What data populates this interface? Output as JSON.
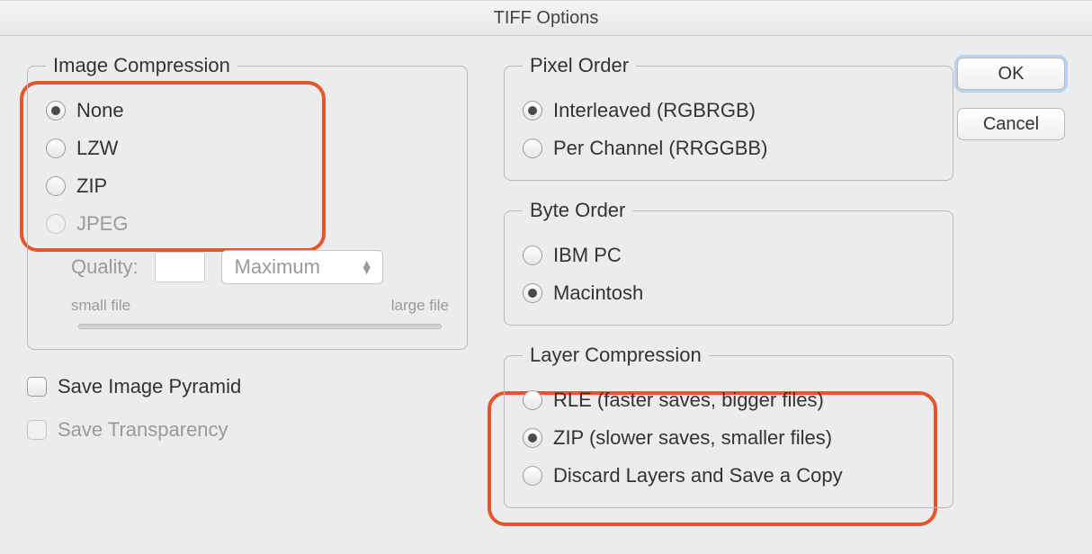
{
  "title": "TIFF Options",
  "buttons": {
    "ok": "OK",
    "cancel": "Cancel"
  },
  "imageCompression": {
    "legend": "Image Compression",
    "options": {
      "none": "None",
      "lzw": "LZW",
      "zip": "ZIP",
      "jpeg": "JPEG"
    },
    "selected": "none",
    "jpegDisabled": true,
    "qualityLabel": "Quality:",
    "qualityValue": "",
    "qualityPreset": "Maximum",
    "sliderLabels": {
      "left": "small file",
      "right": "large file"
    }
  },
  "pixelOrder": {
    "legend": "Pixel Order",
    "options": {
      "interleaved": "Interleaved (RGBRGB)",
      "perchannel": "Per Channel (RRGGBB)"
    },
    "selected": "interleaved"
  },
  "byteOrder": {
    "legend": "Byte Order",
    "options": {
      "ibm": "IBM PC",
      "mac": "Macintosh"
    },
    "selected": "mac"
  },
  "layerCompression": {
    "legend": "Layer Compression",
    "options": {
      "rle": "RLE (faster saves, bigger files)",
      "zip": "ZIP (slower saves, smaller files)",
      "discard": "Discard Layers and Save a Copy"
    },
    "selected": "zip"
  },
  "checks": {
    "saveImagePyramid": {
      "label": "Save Image Pyramid",
      "checked": false,
      "disabled": false
    },
    "saveTransparency": {
      "label": "Save Transparency",
      "checked": false,
      "disabled": true
    }
  }
}
